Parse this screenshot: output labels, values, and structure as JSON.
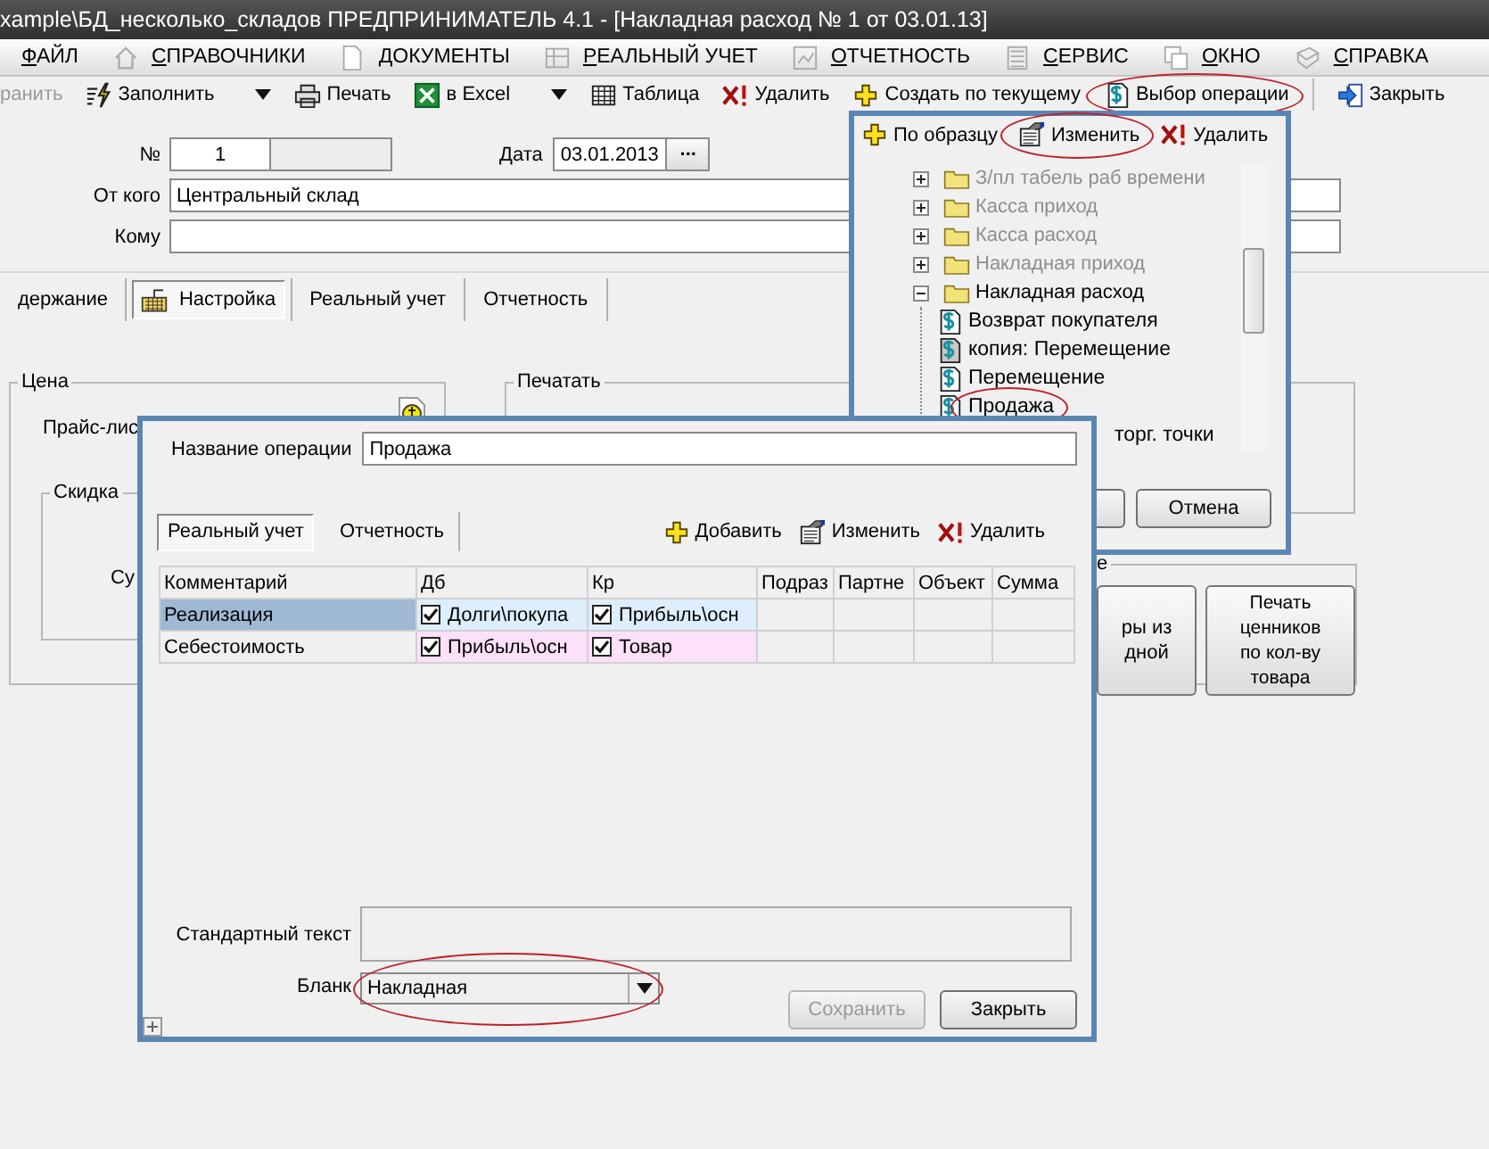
{
  "window": {
    "title": "xample\\БД_несколько_складов  ПРЕДПРИНИМАТЕЛЬ 4.1 - [Накладная расход № 1 от 03.01.13]"
  },
  "menu": [
    {
      "label": "ФАЙЛ",
      "kind": "none"
    },
    {
      "label": "СПРАВОЧНИКИ",
      "kind": "home"
    },
    {
      "label": "ДОКУМЕНТЫ",
      "kind": "page"
    },
    {
      "label": "РЕАЛЬНЫЙ УЧЕТ",
      "kind": "grid"
    },
    {
      "label": "ОТЧЕТНОСТЬ",
      "kind": "chart"
    },
    {
      "label": "СЕРВИС",
      "kind": "calc"
    },
    {
      "label": "ОКНО",
      "kind": "windows"
    },
    {
      "label": "СПРАВКА",
      "kind": "book"
    }
  ],
  "toolbar": [
    {
      "label": "ранить",
      "kind": "plain",
      "disabled": true,
      "dropdown": false,
      "circled": false
    },
    {
      "label": "Заполнить",
      "kind": "fill",
      "disabled": false,
      "dropdown": true,
      "circled": false
    },
    {
      "label": "Печать",
      "kind": "print",
      "disabled": false,
      "dropdown": false,
      "circled": false
    },
    {
      "label": "в Excel",
      "kind": "excel",
      "disabled": false,
      "dropdown": true,
      "circled": false
    },
    {
      "label": "Таблица",
      "kind": "table",
      "disabled": false,
      "dropdown": false,
      "circled": false
    },
    {
      "label": "Удалить",
      "kind": "delete",
      "disabled": false,
      "dropdown": false,
      "circled": false
    },
    {
      "label": "Создать по текущему",
      "kind": "add",
      "disabled": false,
      "dropdown": false,
      "circled": false
    },
    {
      "label": "Выбор операции",
      "kind": "operation",
      "disabled": false,
      "dropdown": false,
      "circled": true
    },
    {
      "label": "Закрыть",
      "kind": "close",
      "disabled": false,
      "dropdown": false,
      "circled": false
    }
  ],
  "form": {
    "number_label": "№",
    "number": "1",
    "date_label": "Дата",
    "date": "03.01.2013",
    "date_button": "...",
    "from_label": "От кого",
    "from": "Центральный склад",
    "to_label": "Кому"
  },
  "tabs": [
    {
      "label": "держание",
      "kind": "plain",
      "selected": false
    },
    {
      "label": "Настройка",
      "kind": "keyboard",
      "selected": true
    },
    {
      "label": "Реальный учет",
      "kind": "plain",
      "selected": false
    },
    {
      "label": "Отчетность",
      "kind": "plain",
      "selected": false
    }
  ],
  "price_group": {
    "title": "Цена",
    "price_list_label": "Прайс-лис",
    "discount_group": {
      "title": "Скидка",
      "sum_label": "Су"
    }
  },
  "print_group": {
    "title": "Печатать"
  },
  "side_group": {
    "title": "е",
    "buttons": [
      "ры из\nдной",
      "Печать ценников\nпо кол-ву товара"
    ]
  },
  "operations_popup": {
    "toolbar": [
      {
        "label": "По образцу",
        "kind": "add",
        "circled": false
      },
      {
        "label": "Изменить",
        "kind": "edit",
        "circled": true
      },
      {
        "label": "Удалить",
        "kind": "delete",
        "circled": false
      }
    ],
    "tree": [
      {
        "label": "З/пл табель раб времени",
        "kind": "folder",
        "expanded": false,
        "disabled": true
      },
      {
        "label": "Касса приход",
        "kind": "folder",
        "expanded": false,
        "disabled": true
      },
      {
        "label": "Касса расход",
        "kind": "folder",
        "expanded": false,
        "disabled": true
      },
      {
        "label": "Накладная приход",
        "kind": "folder",
        "expanded": false,
        "disabled": true
      },
      {
        "label": "Накладная расход",
        "kind": "folder",
        "expanded": true,
        "disabled": false,
        "children": [
          {
            "label": "Возврат покупателя",
            "kind": "operation",
            "circled": false
          },
          {
            "label": "копия: Перемещение",
            "kind": "copy",
            "circled": false
          },
          {
            "label": "Перемещение",
            "kind": "operation",
            "circled": false
          },
          {
            "label": "Продажа",
            "kind": "operation",
            "circled": true
          },
          {
            "label": "торг. точки",
            "kind": "cut",
            "circled": false
          }
        ]
      }
    ],
    "buttons": [
      {
        "label": "Отмена"
      }
    ]
  },
  "dialog": {
    "name_label": "Название операции",
    "name": "Продажа",
    "tabs": [
      {
        "label": "Реальный учет",
        "selected": true
      },
      {
        "label": "Отчетность",
        "selected": false
      }
    ],
    "actions": [
      {
        "label": "Добавить",
        "kind": "add"
      },
      {
        "label": "Изменить",
        "kind": "edit"
      },
      {
        "label": "Удалить",
        "kind": "delete"
      }
    ],
    "table": {
      "columns": [
        "Комментарий",
        "Дб",
        "Кр",
        "Подраз",
        "Партне",
        "Объект",
        "Сумма"
      ],
      "rows": [
        {
          "comment": "Реализация",
          "selected": true,
          "color": "#ddeefc",
          "db": {
            "checked": true,
            "account": "Долги\\покупа"
          },
          "kr": {
            "checked": true,
            "account": "Прибыль\\осн"
          }
        },
        {
          "comment": "Себестоимость",
          "selected": false,
          "color": "#fde0fa",
          "db": {
            "checked": true,
            "account": "Прибыль\\осн"
          },
          "kr": {
            "checked": true,
            "account": "Товар"
          }
        }
      ]
    },
    "standard_text_label": "Стандартный текст",
    "form_label": "Бланк",
    "form_value": "Накладная",
    "form_circled": true,
    "buttons": [
      {
        "label": "Сохранить",
        "disabled": true
      },
      {
        "label": "Закрыть",
        "disabled": false
      }
    ]
  }
}
